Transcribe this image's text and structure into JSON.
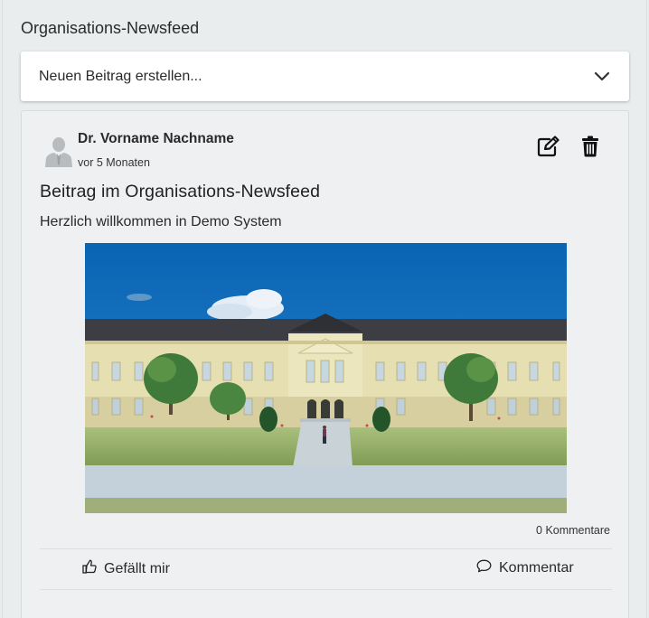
{
  "feed": {
    "title": "Organisations-Newsfeed"
  },
  "composer": {
    "placeholder_label": "Neuen Beitrag erstellen..."
  },
  "post": {
    "author": "Dr. Vorname Nachname",
    "time_ago": "vor 5 Monaten",
    "heading": "Beitrag im Organisations-Newsfeed",
    "body": "Herzlich willkommen in Demo System",
    "comment_count": "0 Kommentare",
    "actions": {
      "like_label": "Gefällt mir",
      "comment_label": "Kommentar"
    }
  },
  "icons": {
    "composer_toggle": "chevron-down-icon",
    "edit": "edit-icon",
    "delete": "trash-icon",
    "like": "thumbs-up-icon",
    "comment": "comment-icon"
  },
  "colors": {
    "page_background": "#eaedee",
    "card_background": "#ffffff",
    "text": "#222222"
  }
}
